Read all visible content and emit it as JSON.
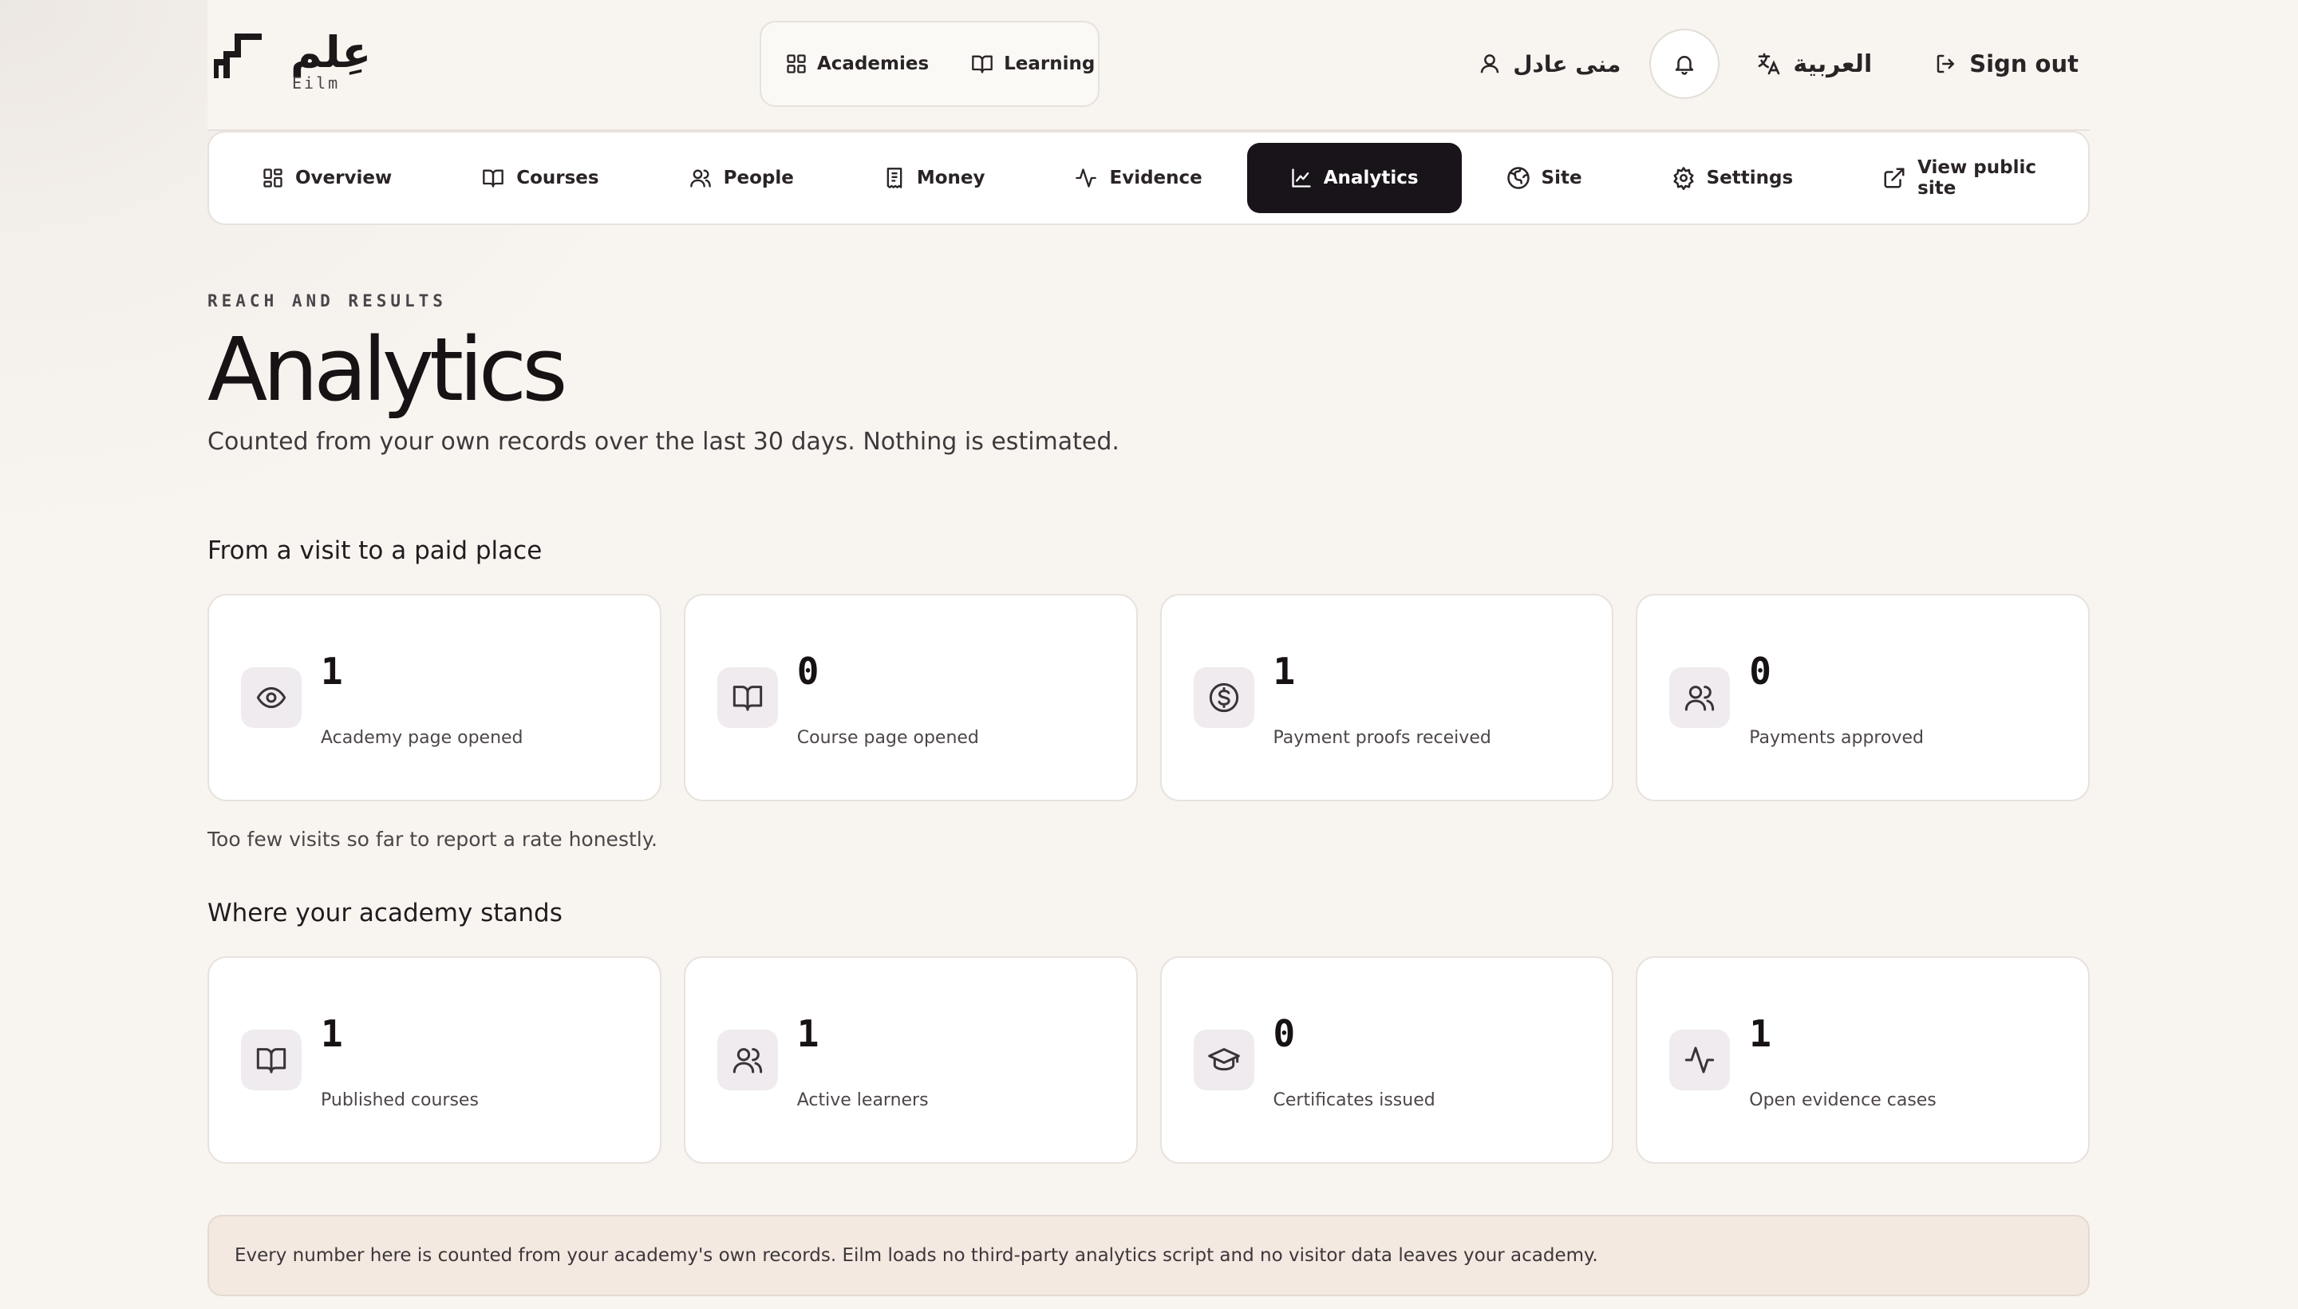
{
  "brand": {
    "wordmark_ar": "عِلم",
    "wordmark_en": "Eilm"
  },
  "mainnav": {
    "academies": "Academies",
    "learning": "Learning"
  },
  "user": {
    "name": "منى عادل",
    "language": "العربية",
    "signout": "Sign out"
  },
  "subnav": {
    "items": [
      {
        "label": "Overview",
        "icon": "grid-icon"
      },
      {
        "label": "Courses",
        "icon": "book-icon"
      },
      {
        "label": "People",
        "icon": "users-icon"
      },
      {
        "label": "Money",
        "icon": "receipt-icon"
      },
      {
        "label": "Evidence",
        "icon": "activity-icon"
      },
      {
        "label": "Analytics",
        "icon": "chart-line-icon",
        "active": true
      },
      {
        "label": "Site",
        "icon": "globe-icon"
      },
      {
        "label": "Settings",
        "icon": "gear-icon"
      },
      {
        "label": "View public site",
        "icon": "external-link-icon"
      }
    ]
  },
  "header": {
    "eyebrow": "REACH AND RESULTS",
    "title": "Analytics",
    "subtitle": "Counted from your own records over the last 30 days. Nothing is estimated."
  },
  "funnel": {
    "heading": "From a visit to a paid place",
    "cards": [
      {
        "value": "1",
        "label": "Academy page opened",
        "icon": "eye-icon"
      },
      {
        "value": "0",
        "label": "Course page opened",
        "icon": "book-icon"
      },
      {
        "value": "1",
        "label": "Payment proofs received",
        "icon": "dollar-circle-icon"
      },
      {
        "value": "0",
        "label": "Payments approved",
        "icon": "users-icon"
      }
    ],
    "note": "Too few visits so far to report a rate honestly."
  },
  "standing": {
    "heading": "Where your academy stands",
    "cards": [
      {
        "value": "1",
        "label": "Published courses",
        "icon": "book-icon"
      },
      {
        "value": "1",
        "label": "Active learners",
        "icon": "users-icon"
      },
      {
        "value": "0",
        "label": "Certificates issued",
        "icon": "graduation-cap-icon"
      },
      {
        "value": "1",
        "label": "Open evidence cases",
        "icon": "activity-icon"
      }
    ]
  },
  "footer": {
    "note": "Every number here is counted from your academy's own records. Eilm loads no third-party analytics script and no visitor data leaves your academy."
  },
  "colors": {
    "accent_dark": "#19141a",
    "background": "#f8f5f1",
    "icon_tile": "#efebee",
    "footer_bg": "#f3e9e1"
  }
}
